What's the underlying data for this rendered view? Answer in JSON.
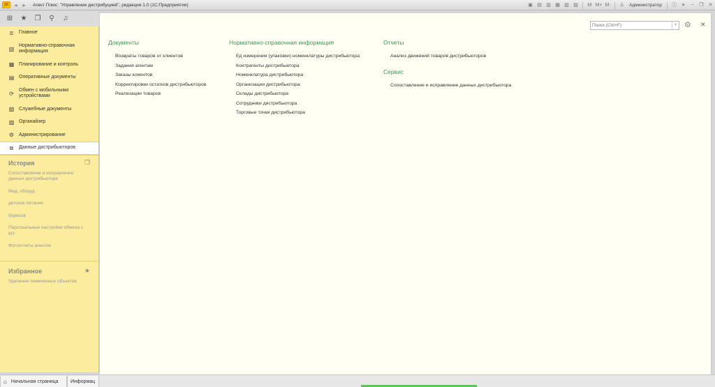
{
  "window": {
    "logo_text": "1С",
    "title": "Агент Плюс: \"Управление дистрибуцией\", редакция 1.0  (1С:Предприятие)",
    "user": "Администратор",
    "toolbar_icons": [
      "save-icon",
      "print-icon",
      "copy-icon",
      "calc-icon",
      "calendar-icon",
      "compare-icon"
    ],
    "mem_labels": [
      "M",
      "M+",
      "M-"
    ]
  },
  "sidebar": {
    "items": [
      {
        "label": "Главное",
        "icon": "≣"
      },
      {
        "label": "Нормативно-справочная информация",
        "icon": "▥"
      },
      {
        "label": "Планирование и контроль",
        "icon": "▦"
      },
      {
        "label": "Оперативные документы",
        "icon": "▤"
      },
      {
        "label": "Обмен с мобильными устройствами",
        "icon": "⟳"
      },
      {
        "label": "Служебные документы",
        "icon": "▧"
      },
      {
        "label": "Органайзер",
        "icon": "▨"
      },
      {
        "label": "Администрирование",
        "icon": "⚙"
      },
      {
        "label": "Данные дистрибьюторов",
        "icon": "⧉"
      }
    ],
    "history": {
      "title": "История",
      "items": [
        "Сопоставление и исправление данных дистрибьютора",
        "Мед. оборуд",
        "детское питание",
        "борисов",
        "Персональные настройки обмена с МУ",
        "Фотоотчеты агентов"
      ]
    },
    "favorites": {
      "title": "Избранное",
      "items": [
        "Удаление помеченных объектов"
      ]
    }
  },
  "main": {
    "search_placeholder": "Поиск (Ctrl+F)",
    "search_clear": "×",
    "columns": {
      "documents": {
        "title": "Документы",
        "links": [
          "Возвраты товаров от клиентов",
          "Задания агентам",
          "Заказы клиентов",
          "Корректировки остатков дистрибьюторов",
          "Реализации товаров"
        ]
      },
      "reference": {
        "title": "Нормативно-справочная информация",
        "links": [
          "Ед измерения (упаковки)  номенклатуры дистрибьютора",
          "Контрагенты дистрибьютора",
          "Номенклатура дистрибьютора",
          "Организации дистрибьютора",
          "Склады дистрибьютора",
          "Сотрудники дистрибьютора",
          "Торговые точки дистрибьютора"
        ]
      },
      "reports": {
        "title": "Отчеты",
        "links": [
          "Анализ движений товаров дистрибьюторов"
        ]
      },
      "service": {
        "title": "Сервис",
        "links": [
          "Сопоставление и исправление данных дистрибьютора"
        ]
      }
    }
  },
  "bottom_tabs": {
    "home": "Начальная страница",
    "info": "Информац"
  }
}
